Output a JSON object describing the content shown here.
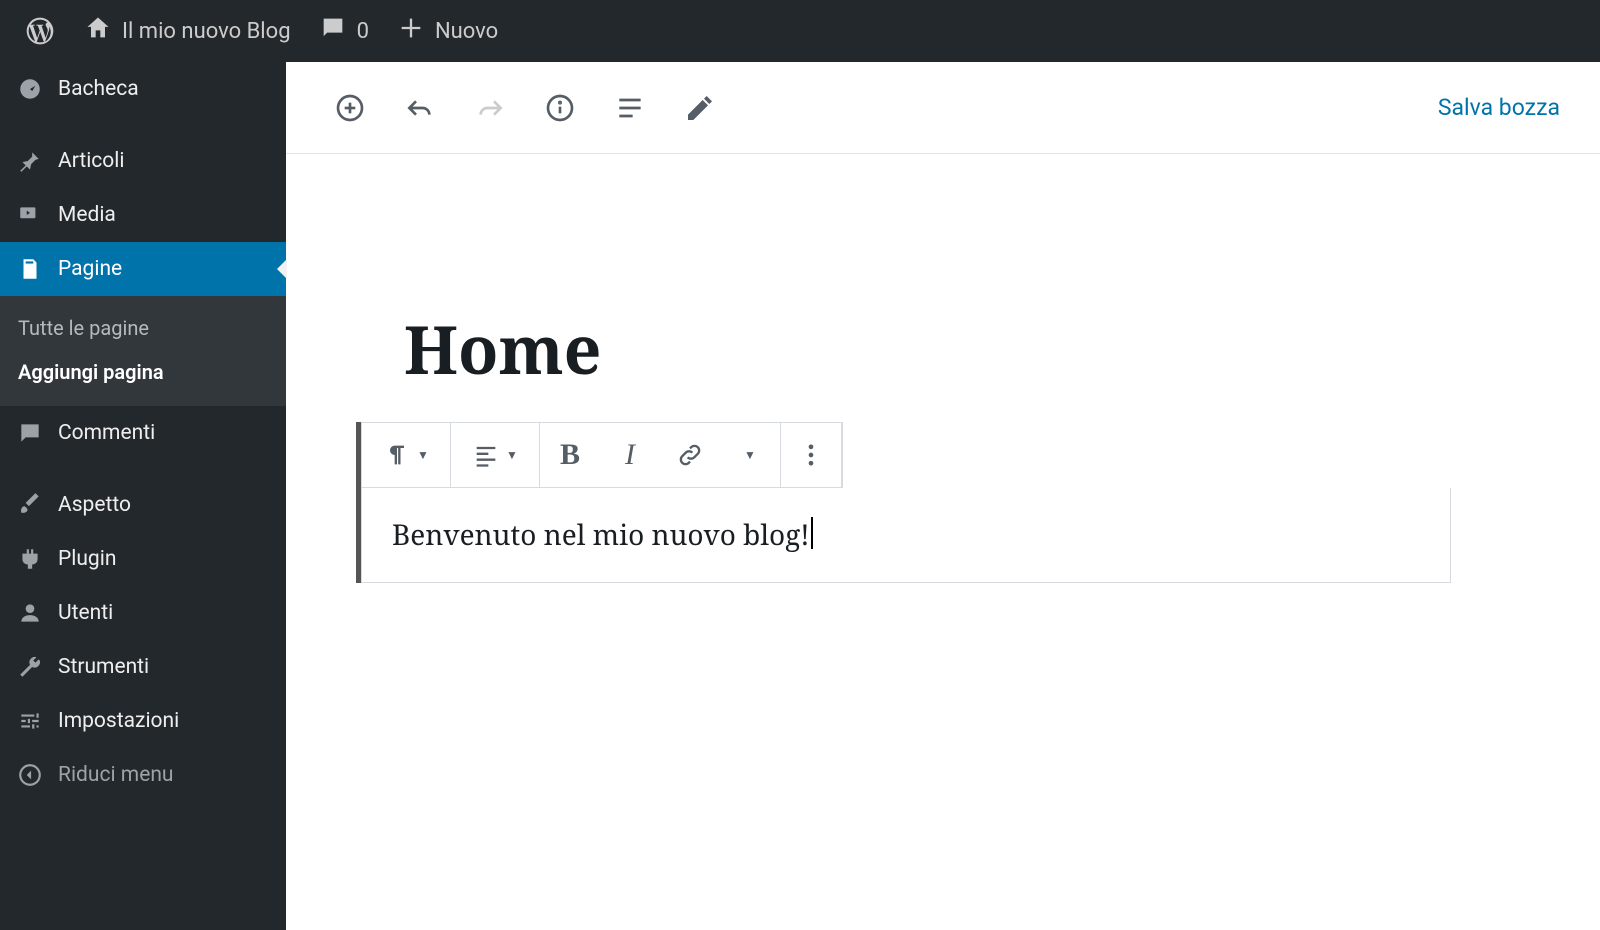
{
  "adminbar": {
    "site_title": "Il mio nuovo Blog",
    "comments_count": "0",
    "new_label": "Nuovo"
  },
  "sidebar": {
    "dashboard": "Bacheca",
    "posts": "Articoli",
    "media": "Media",
    "pages": "Pagine",
    "pages_sub_all": "Tutte le pagine",
    "pages_sub_add": "Aggiungi pagina",
    "comments": "Commenti",
    "appearance": "Aspetto",
    "plugins": "Plugin",
    "users": "Utenti",
    "tools": "Strumenti",
    "settings": "Impostazioni",
    "collapse": "Riduci menu"
  },
  "editor": {
    "save_draft": "Salva bozza",
    "post_title": "Home",
    "paragraph_text": "Benvenuto nel mio nuovo blog!"
  }
}
